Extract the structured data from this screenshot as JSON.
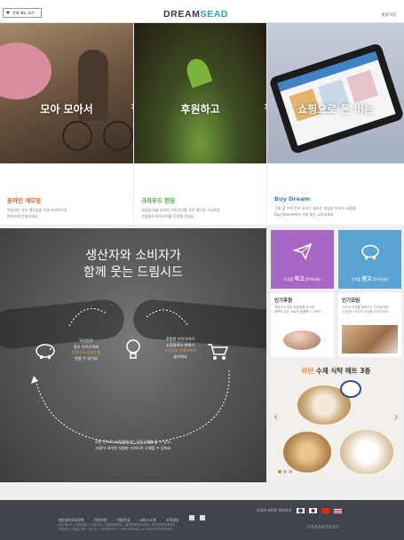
{
  "header": {
    "menu_button": "전체 메뉴 보기",
    "logo_main": "DREAM",
    "logo_accent": "SEAD",
    "login": "회원가입"
  },
  "banners": [
    {
      "caption": "모아 모아서",
      "title": "온라인 계모임",
      "desc_line1": "복잡하던 우리 계모임을 이제 온라인으로",
      "desc_line2": "편리하게 운영하세요"
    },
    {
      "caption": "후원하고",
      "title": "크라우드 펀딩",
      "desc_line1": "세상을 바꿀 놀라운 아이디어를 가진 개인과 스타트업",
      "desc_line2": "기업들의 아이디어를 후원해 주세요"
    },
    {
      "caption": "쇼핑으로 돈 버는",
      "title": "Buy Dream",
      "desc_line1": "구매 할 수록 돈이 모이는 새로운 개념의 온라인 쇼핑몰!",
      "desc_line2": "Buy Dream에서 기분 좋은 쇼핑하세요"
    }
  ],
  "main": {
    "title_line1": "생산자와 소비자가",
    "title_line2": "함께 웃는 드림시드",
    "left": {
      "line1": "모인돈은",
      "line2": "좋은 아이디어에",
      "line3": "후원하고 리워드를",
      "line4": "받을 수 있어요"
    },
    "right": {
      "line1": "후원한 아이디어가",
      "line2": "쇼핑몰에서 판매시",
      "line3": "수익금을 후원자에게",
      "line4": "돌려줘요"
    },
    "bottom_line1": "모인 돈으로 쇼핑몰에서는 공동구매를 할 수 있고,",
    "bottom_line2": "사람이 모이면 저렴한 가격으로 구매할 수 있어요"
  },
  "tiles": [
    {
      "pre": "투자를",
      "strong": "하고",
      "post": "참여하세요",
      "icon": "paper-plane-icon"
    },
    {
      "pre": "투자를",
      "strong": "받고",
      "post": "참여하세요",
      "icon": "piggy-bank-icon"
    }
  ],
  "popular": [
    {
      "title": "인기후원",
      "desc_line1": "세련되게 여러 화장품을 하나로",
      "desc_line2": "콤팩트 담은 새로운 볼륨톡스 스위치"
    },
    {
      "title": "인기모임",
      "desc_line1": "100년 가게를 향해가는 우리들처럼",
      "desc_line2": "소상공인 모두의 모임을 도와주세요!"
    }
  ],
  "slider": {
    "title_pre": "라탄",
    "title_rest": " 수제 식탁 매트 3종"
  },
  "footer": {
    "links": [
      "개인정보보호정책",
      "이용약관",
      "이용안내",
      "서비스소개",
      "고객센터"
    ],
    "language_label": "다국어 사이트 바로가기",
    "info_line1": "(주)드림시드 | 서울특별시 | 대표이사 | 사업자등록번호 | 통신판매업신고번호 | 개인정보관리책임자",
    "info_line2": "고객센터 | 이메일 | 팩스 | 호스팅 | COPYRIGHT ⓒ DREAMSEAD ALL RIGHTS RESERVED",
    "logo": "DREAMSEAD"
  },
  "colors": {
    "accent": "#2ea3b3",
    "orange": "#e05a1f",
    "green": "#4aa33c",
    "blue": "#3b7bbf",
    "purple": "#a668c4",
    "sky": "#5aa4d4"
  }
}
